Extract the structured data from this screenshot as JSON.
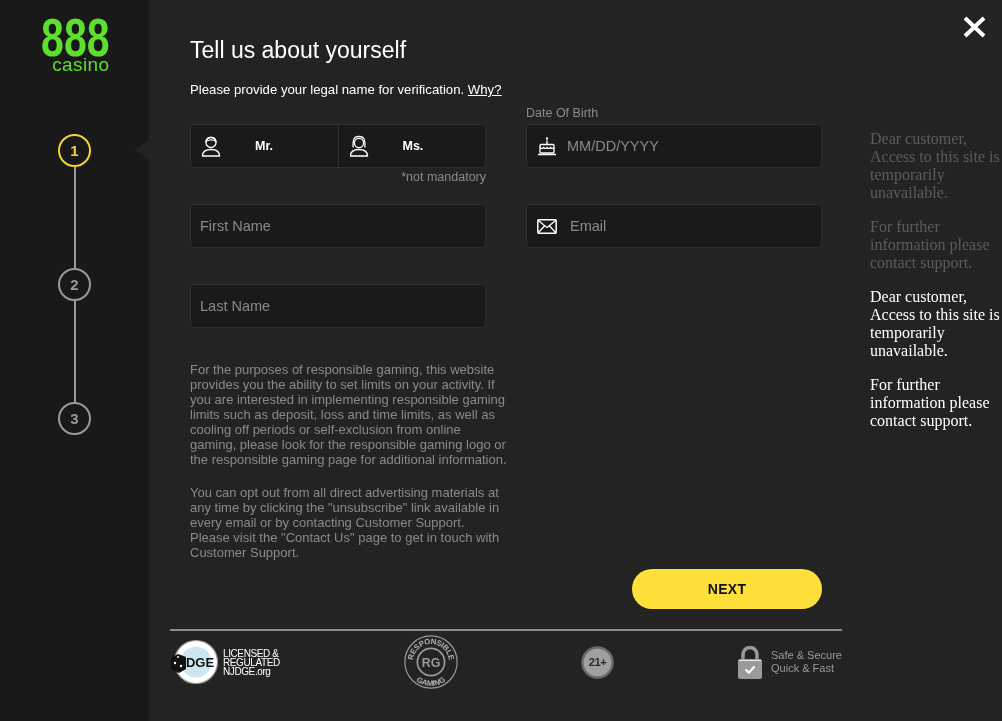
{
  "logo": {
    "mark": "888",
    "word": "casino"
  },
  "steps": [
    {
      "label": "1",
      "selected": true
    },
    {
      "label": "2",
      "selected": false
    },
    {
      "label": "3",
      "selected": false
    }
  ],
  "form": {
    "title": "Tell us about yourself",
    "subtitle": "Please provide your legal name for verification.",
    "why_link": "Why?",
    "title_options": [
      {
        "label": "Mr.",
        "selected": false
      },
      {
        "label": "Ms.",
        "selected": false
      }
    ],
    "title_note": "*not mandatory",
    "date_of_birth": {
      "label": "Date Of Birth",
      "placeholder": "MM/DD/YYYY"
    },
    "first_name": {
      "placeholder": "First Name"
    },
    "email": {
      "placeholder": "Email"
    },
    "last_name": {
      "placeholder": "Last Name"
    },
    "disclaimers": [
      "For the purposes of responsible gaming, this website provides you the ability to set limits on your activity. If you are interested in implementing responsible gaming limits such as deposit, loss and time limits, as well as cooling off periods or self-exclusion from online gaming, please look for the responsible gaming logo or the responsible gaming page for additional information.",
      "You can opt out from all direct advertising materials at any time by clicking the \"unsubscribe\" link available in every email or by contacting Customer Support. Please visit the \"Contact Us\" page to get in touch with Customer Support."
    ],
    "next_button": "NEXT"
  },
  "footer": {
    "license_badge": "DGE",
    "license_text": "LICENSED &\nREGULATED\nNJDGE.org",
    "rg_seal": {
      "top": "RESPONSIBLE",
      "center": "RG",
      "bottom": "GAMING"
    },
    "age_badge": "21+",
    "security_text": "Safe & Secure\nQuick & Fast"
  },
  "notices": [
    {
      "faded": true,
      "paragraphs": [
        "Dear customer,\nAccess to this site is temporarily unavailable.",
        "For further information please contact support."
      ]
    },
    {
      "faded": false,
      "paragraphs": [
        "Dear customer,\nAccess to this site is temporarily unavailable.",
        "For further information please contact support."
      ]
    }
  ]
}
